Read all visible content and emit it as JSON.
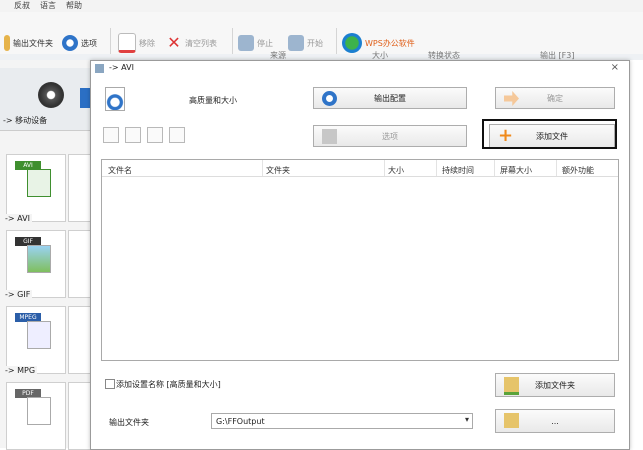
{
  "menu": {
    "items": [
      "反叔",
      "语言",
      "帮助"
    ]
  },
  "toolbar": {
    "output_folder": "输出文件夹",
    "options": "选项",
    "remove": "移除",
    "clear_list": "清空列表",
    "stop": "停止",
    "start": "开始",
    "wps": "WPS办公软件"
  },
  "main_header": {
    "cols": [
      "来源",
      "大小",
      "转换状态",
      "输出 [F3]"
    ]
  },
  "sidebar": {
    "category": "-> 移动设备",
    "items": [
      {
        "label": "-> AVI",
        "badge": "AVI",
        "color": "#3f8f2f"
      },
      {
        "label": "-> GIF",
        "badge": "GIF",
        "color": "#333333"
      },
      {
        "label": "-> MPG",
        "badge": "MPEG",
        "color": "#2b5ea8"
      },
      {
        "label": "",
        "badge": "PDF",
        "color": "#666666"
      }
    ]
  },
  "dialog": {
    "title": "-> AVI",
    "quality": "高质量和大小",
    "output_config": "输出配置",
    "ok": "确定",
    "options": "选项",
    "add_file": "添加文件",
    "columns": [
      "文件名",
      "文件夹",
      "大小",
      "持续时间",
      "屏幕大小",
      "额外功能"
    ],
    "add_setting_name": "添加设置名称 [高质量和大小]",
    "add_folder": "添加文件夹",
    "output_folder_label": "输出文件夹",
    "output_folder_value": "G:\\FFOutput",
    "browse_tail": "..."
  },
  "colors": {
    "highlight_border": "#111111",
    "add_icon": "#f08a1c"
  }
}
